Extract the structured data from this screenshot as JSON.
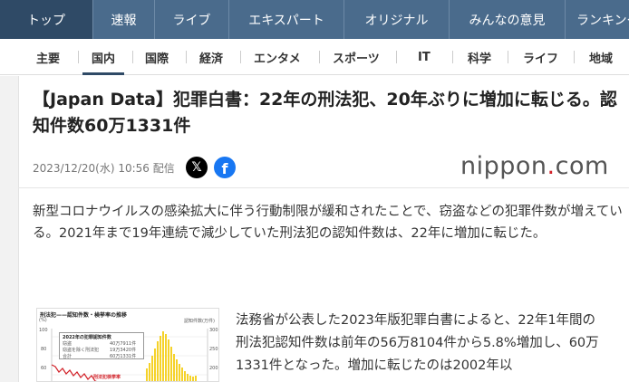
{
  "topnav": {
    "items": [
      "トップ",
      "速報",
      "ライブ",
      "エキスパート",
      "オリジナル",
      "みんなの意見",
      "ランキング"
    ]
  },
  "subnav": {
    "items": [
      "主要",
      "国内",
      "国際",
      "経済",
      "エンタメ",
      "スポーツ",
      "IT",
      "科学",
      "ライフ",
      "地域"
    ]
  },
  "article": {
    "title": "【Japan Data】犯罪白書：22年の刑法犯、20年ぶりに増加に転じる。認知件数60万1331件",
    "date": "2023/12/20(水) 10:56 配信",
    "source_logo": "nippon.com",
    "lead": "新型コロナウイルスの感染拡大に伴う行動制限が緩和されたことで、窃盗などの犯罪件数が増えている。2021年まで19年連続で減少していた刑法犯の認知件数は、22年に増加に転じた。",
    "body": "法務省が公表した2023年版犯罪白書によると、22年1年間の刑法犯認知件数は前年の56万8104件から5.8%増加し、60万1331件となった。増加に転じたのは2002年以"
  },
  "figure": {
    "title": "刑法犯——認知件数・検挙率の推移",
    "ylabel_left": "(%)",
    "ylabel_right": "認知件数(万件)",
    "legend_title": "2022年の犯罪認知件数",
    "legend_rows": [
      "40万7911件",
      "19万3420件",
      "60万1331件"
    ],
    "legend_names": [
      "窃盗",
      "窃盗を除く刑法犯",
      "合計"
    ],
    "annotation": "刑法犯検挙率",
    "yticks_left": [
      "100",
      "80",
      "60"
    ],
    "yticks_right": [
      "300",
      "250",
      "200"
    ]
  },
  "colors": {
    "topnav_bg": "#4a6b8c",
    "topnav_active": "#2f4a66",
    "accent_red": "#d2232a",
    "bar_yellow": "#f5d229",
    "line_red": "#d2232a"
  }
}
